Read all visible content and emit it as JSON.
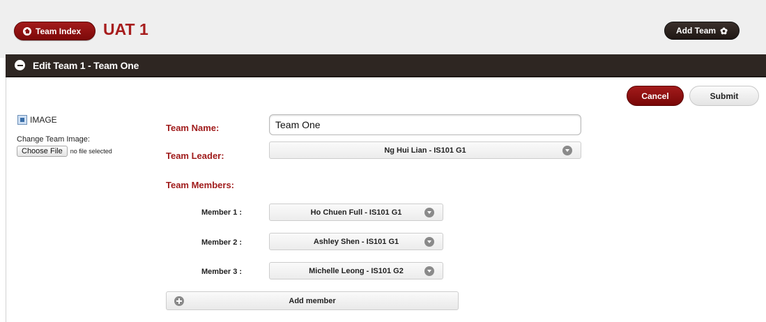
{
  "header": {
    "index_button_label": "Team Index",
    "title": "UAT 1",
    "add_team_label": "Add Team"
  },
  "section": {
    "title": "Edit Team 1 - Team One"
  },
  "actions": {
    "cancel_label": "Cancel",
    "submit_label": "Submit"
  },
  "image": {
    "placeholder_text": "IMAGE",
    "change_label": "Change Team Image:",
    "choose_file_label": "Choose File",
    "file_status": "no file selected"
  },
  "form": {
    "team_name_label": "Team Name:",
    "team_name_value": "Team One",
    "team_leader_label": "Team Leader:",
    "team_leader_value": "Ng Hui Lian - IS101 G1",
    "team_members_label": "Team Members:",
    "members": [
      {
        "label": "Member 1 :",
        "value": "Ho Chuen Full - IS101 G1"
      },
      {
        "label": "Member 2 :",
        "value": "Ashley Shen - IS101 G1"
      },
      {
        "label": "Member 3 :",
        "value": "Michelle Leong - IS101 G2"
      }
    ],
    "add_member_label": "Add member"
  },
  "colors": {
    "brand_red": "#a01c1c",
    "dark_bar": "#2e2622"
  },
  "icons": [
    "home-icon",
    "gear-icon",
    "minus-icon",
    "image-icon",
    "chevron-down-icon",
    "plus-icon"
  ]
}
